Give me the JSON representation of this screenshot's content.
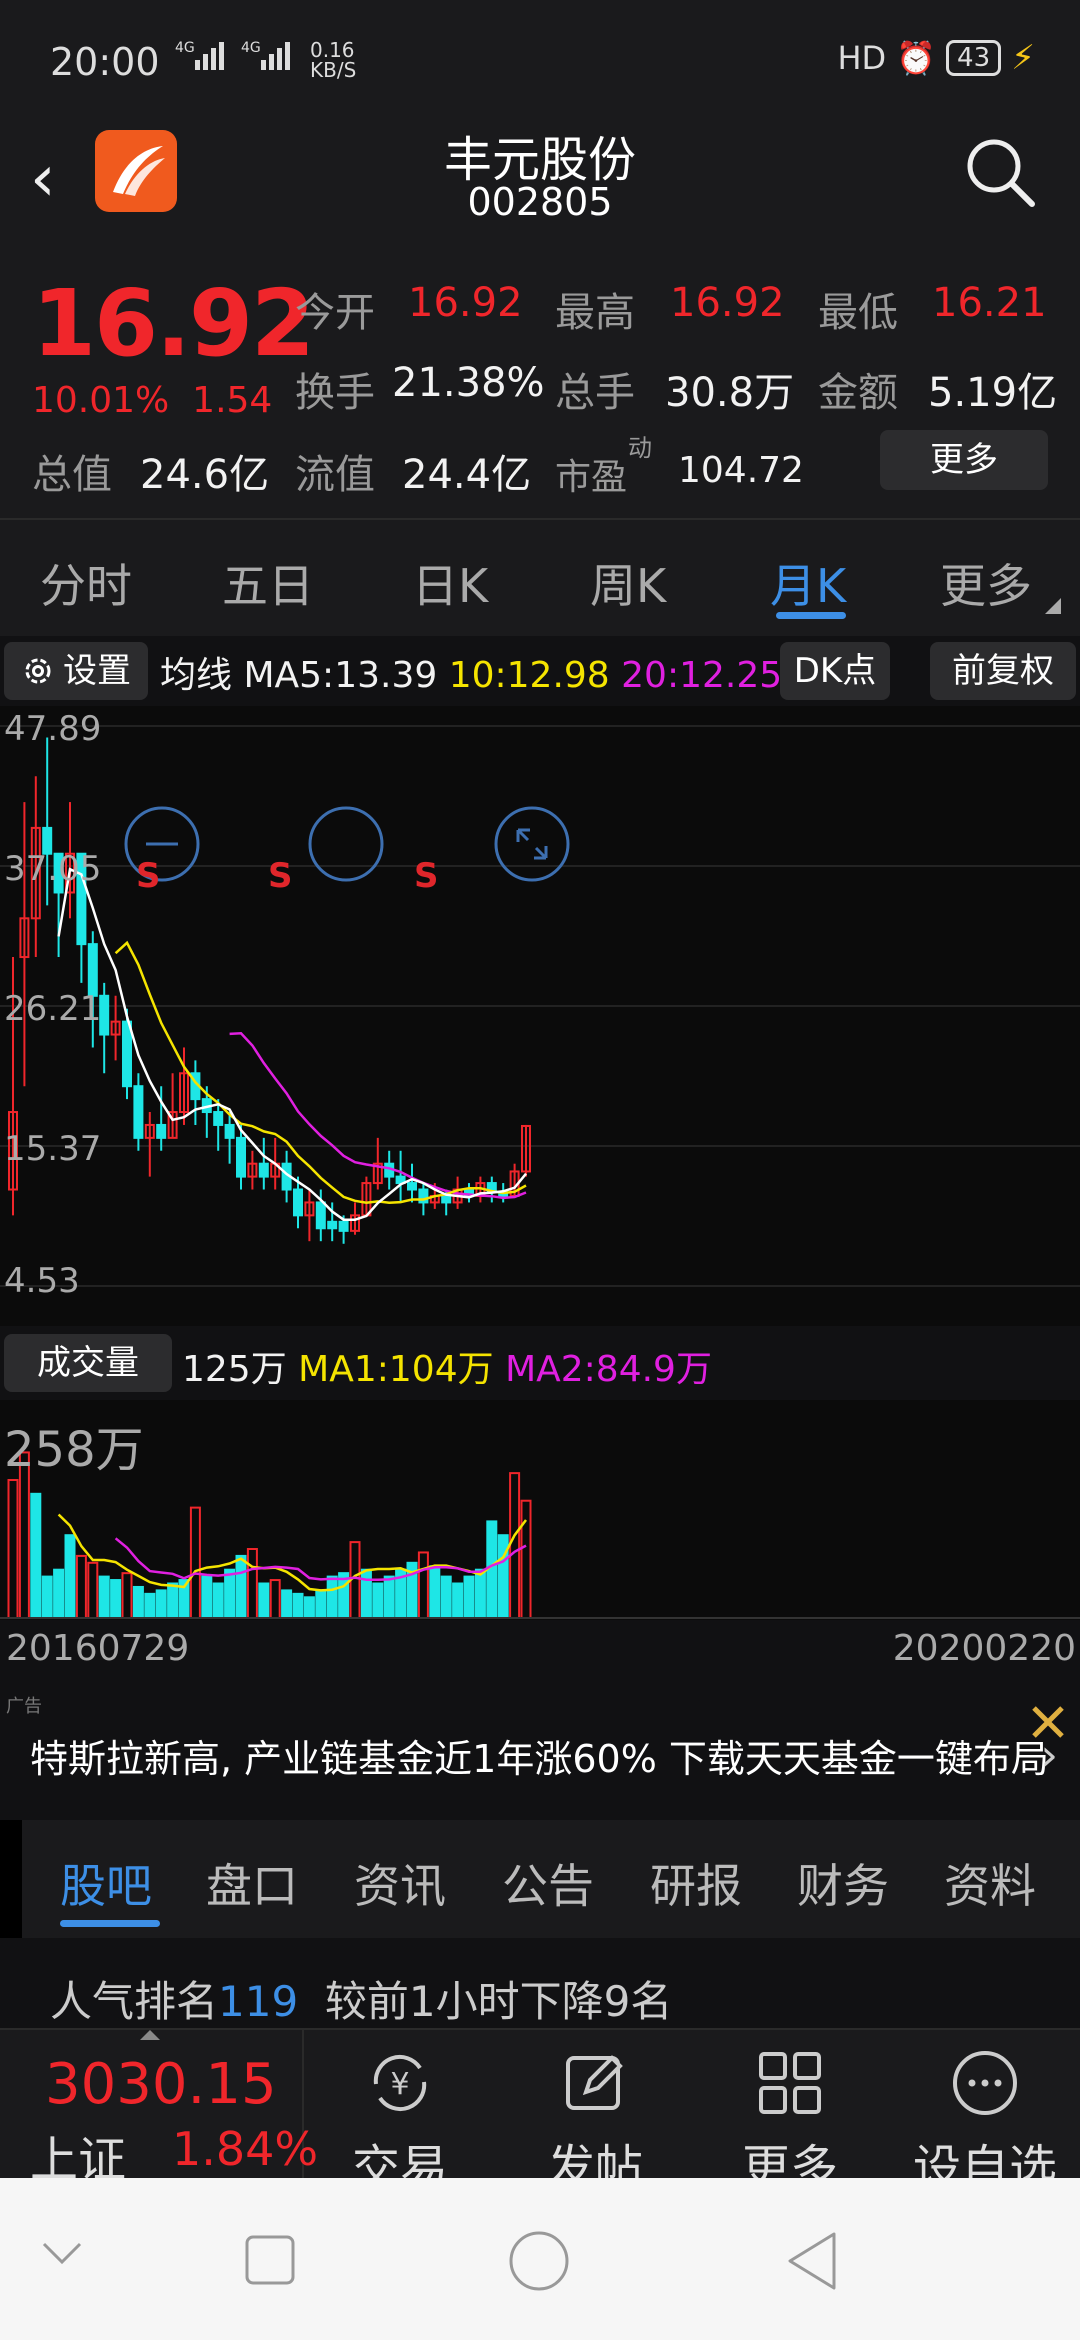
{
  "status": {
    "time": "20:00",
    "network": "4G 4G",
    "speed": "0.16 KB/S",
    "hd": "HD",
    "battery": "43"
  },
  "header": {
    "title": "丰元股份",
    "code": "002805"
  },
  "quote": {
    "price": "16.92",
    "change_pct": "10.01%",
    "change": "1.54",
    "open_label": "今开",
    "open": "16.92",
    "high_label": "最高",
    "high": "16.92",
    "low_label": "最低",
    "low": "16.21",
    "turnover_label": "换手",
    "turnover": "21.38%",
    "volume_label": "总手",
    "volume": "30.8万",
    "amount_label": "金额",
    "amount": "5.19亿",
    "mktcap_label": "总值",
    "mktcap": "24.6亿",
    "float_label": "流值",
    "float": "24.4亿",
    "pe_label": "市盈",
    "pe_sup": "动",
    "pe": "104.72",
    "more": "更多"
  },
  "tabs": [
    "分时",
    "五日",
    "日K",
    "周K",
    "月K",
    "更多"
  ],
  "chartbar": {
    "settings": "设置",
    "ma_label": "均线",
    "ma5": "MA5:13.39",
    "ma10": "10:12.98",
    "ma20": "20:12.25",
    "dk": "DK点",
    "adjust": "前复权"
  },
  "kline": {
    "ticks": [
      "47.89",
      "37.05",
      "26.21",
      "15.37",
      "4.53"
    ],
    "markers": [
      "S",
      "S",
      "S"
    ]
  },
  "volbar": {
    "label": "成交量",
    "vol": "125万",
    "ma1": "MA1:104万",
    "ma2": "MA2:84.9万",
    "max": "258万"
  },
  "dates": {
    "start": "20160729",
    "end": "20200220"
  },
  "ad": {
    "tag": "广告",
    "text": "特斯拉新高, 产业链基金近1年涨60% 下载天天基金一键布局"
  },
  "subtabs": [
    "股吧",
    "盘口",
    "资讯",
    "公告",
    "研报",
    "财务",
    "资料"
  ],
  "rank": {
    "label": "人气排名",
    "num": "119",
    "desc": "较前1小时下降9名"
  },
  "bottom": {
    "index_value": "3030.15",
    "index_name": "上证",
    "index_pct": "1.84%",
    "items": [
      "交易",
      "发帖",
      "更多",
      "设自选"
    ]
  },
  "colors": {
    "up": "#f0262b",
    "down": "#1ee6e6",
    "accent": "#3d8fe6",
    "ma5": "#ffffff",
    "ma10": "#f5e400",
    "ma20": "#e020e0"
  },
  "chart_data": {
    "type": "candlestick",
    "ylim": [
      4.53,
      47.89
    ],
    "candles": [
      [
        18,
        12,
        30,
        10,
        1
      ],
      [
        30,
        33,
        42,
        20,
        1
      ],
      [
        33,
        40,
        44,
        30,
        1
      ],
      [
        40,
        38,
        47,
        34,
        0
      ],
      [
        38,
        35,
        38,
        30,
        0
      ],
      [
        35,
        38,
        42,
        33,
        1
      ],
      [
        38,
        31,
        38,
        28,
        0
      ],
      [
        31,
        27,
        32,
        23,
        0
      ],
      [
        27,
        24,
        28,
        21,
        0
      ],
      [
        24,
        25,
        27,
        22,
        1
      ],
      [
        25,
        20,
        26,
        19,
        0
      ],
      [
        20,
        16,
        21,
        15,
        0
      ],
      [
        16,
        17,
        18,
        13,
        1
      ],
      [
        17,
        16,
        20,
        15,
        0
      ],
      [
        16,
        18,
        21,
        16,
        1
      ],
      [
        18,
        21,
        23,
        17,
        1
      ],
      [
        21,
        19,
        22,
        17,
        0
      ],
      [
        19,
        18,
        20,
        16,
        0
      ],
      [
        18,
        17,
        19,
        15,
        0
      ],
      [
        17,
        16,
        18,
        14,
        0
      ],
      [
        16,
        13,
        17,
        12,
        0
      ],
      [
        13,
        14,
        15,
        12,
        1
      ],
      [
        14,
        13,
        16,
        12,
        0
      ],
      [
        13,
        14,
        16,
        12,
        1
      ],
      [
        14,
        12,
        15,
        11,
        0
      ],
      [
        12,
        10,
        13,
        9,
        0
      ],
      [
        10,
        11,
        12,
        8,
        1
      ],
      [
        11,
        9,
        12,
        8,
        0
      ],
      [
        9,
        9.5,
        11,
        8,
        0
      ],
      [
        9.5,
        8.8,
        10,
        7.8,
        0
      ],
      [
        8.8,
        10,
        11,
        8.5,
        1
      ],
      [
        10,
        12.5,
        13,
        10,
        1
      ],
      [
        12.5,
        14,
        16,
        12,
        1
      ],
      [
        14,
        13,
        15,
        12,
        0
      ],
      [
        13,
        12.5,
        15,
        11,
        0
      ],
      [
        12.5,
        12,
        14,
        11,
        0
      ],
      [
        12,
        11,
        12.5,
        10,
        0
      ],
      [
        11,
        11.5,
        12.5,
        10.5,
        1
      ],
      [
        11.5,
        11,
        12,
        10,
        0
      ],
      [
        11,
        12,
        13,
        10.5,
        1
      ],
      [
        12,
        11.5,
        12.5,
        11,
        0
      ],
      [
        11.5,
        12.5,
        13,
        11,
        1
      ],
      [
        12.5,
        11.8,
        13,
        11,
        0
      ],
      [
        11.8,
        11.5,
        12.5,
        11,
        0
      ],
      [
        11.5,
        13.4,
        14,
        11.5,
        1
      ],
      [
        13.4,
        16.92,
        17,
        13,
        1
      ]
    ],
    "volumes": [
      [
        200,
        1
      ],
      [
        240,
        1
      ],
      [
        180,
        0
      ],
      [
        60,
        0
      ],
      [
        70,
        0
      ],
      [
        120,
        0
      ],
      [
        90,
        1
      ],
      [
        80,
        1
      ],
      [
        60,
        0
      ],
      [
        55,
        0
      ],
      [
        65,
        1
      ],
      [
        45,
        0
      ],
      [
        35,
        0
      ],
      [
        40,
        0
      ],
      [
        50,
        0
      ],
      [
        55,
        0
      ],
      [
        160,
        1
      ],
      [
        60,
        0
      ],
      [
        50,
        0
      ],
      [
        70,
        0
      ],
      [
        90,
        0
      ],
      [
        100,
        1
      ],
      [
        50,
        0
      ],
      [
        55,
        1
      ],
      [
        40,
        0
      ],
      [
        35,
        0
      ],
      [
        30,
        0
      ],
      [
        40,
        0
      ],
      [
        60,
        0
      ],
      [
        65,
        0
      ],
      [
        110,
        1
      ],
      [
        70,
        0
      ],
      [
        50,
        0
      ],
      [
        60,
        0
      ],
      [
        70,
        0
      ],
      [
        80,
        0
      ],
      [
        95,
        1
      ],
      [
        75,
        0
      ],
      [
        60,
        0
      ],
      [
        50,
        0
      ],
      [
        60,
        0
      ],
      [
        70,
        0
      ],
      [
        140,
        0
      ],
      [
        120,
        0
      ],
      [
        210,
        1
      ],
      [
        170,
        1
      ]
    ]
  }
}
